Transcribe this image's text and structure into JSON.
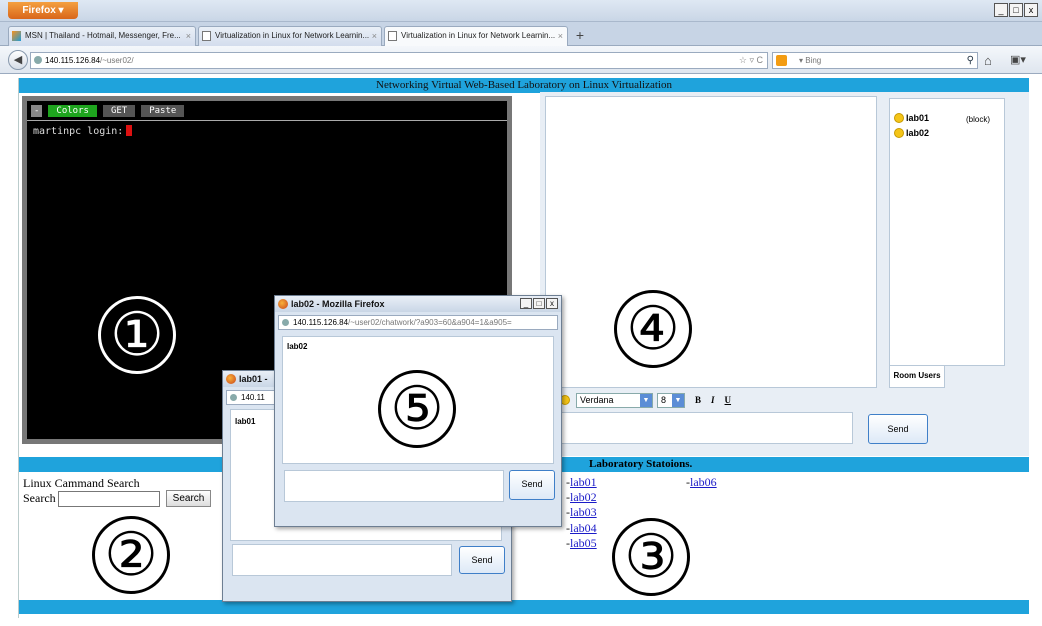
{
  "browser": {
    "menu_label": "Firefox ▾",
    "window_controls": [
      "_",
      "□",
      "x"
    ],
    "tabs": [
      {
        "label": "MSN | Thailand - Hotmail, Messenger, Fre..."
      },
      {
        "label": "Virtualization in Linux for Network Learnin..."
      },
      {
        "label": "Virtualization in Linux for Network Learnin..."
      }
    ],
    "tab_close": "×",
    "new_tab": "+",
    "url_host": "140.115.126.84",
    "url_path": "/~user02/",
    "url_right": "☆ ▿ C",
    "search_engine": "Bing",
    "search_placeholder": "▾ Bing"
  },
  "page": {
    "banner": "Networking Virtual Web-Based Laboratory on Linux Virtualization",
    "terminal": {
      "dash": "-",
      "colors_btn": "Colors",
      "get_btn": "GET",
      "paste_btn": "Paste",
      "prompt": "martinpc login:"
    },
    "chat": {
      "users": [
        {
          "name": "lab01",
          "tag": "(block)"
        },
        {
          "name": "lab02",
          "tag": ""
        }
      ],
      "room_tab": "Room Users",
      "font_name": "Verdana",
      "font_size": "8",
      "bold": "B",
      "italic": "I",
      "underline": "U",
      "send": "Send"
    },
    "search": {
      "title": "Linux Cammand Search",
      "label": "Search",
      "button": "Search"
    },
    "labs": {
      "title": "Laboratory Statoions.",
      "prefix": "-",
      "items": [
        "lab01",
        "lab02",
        "lab03",
        "lab04",
        "lab05",
        "lab06"
      ]
    }
  },
  "annotations": [
    "①",
    "②",
    "③",
    "④",
    "⑤"
  ],
  "popups": {
    "lab02": {
      "title": "lab02 - Mozilla Firefox",
      "url_host": "140.115.126.84",
      "url_path": "/~user02/chatwork/?a903=60&a904=1&a905=",
      "room": "lab02",
      "send": "Send"
    },
    "lab01": {
      "title": "lab01 -",
      "url_host": "140.11",
      "room": "lab01",
      "send": "Send"
    }
  }
}
